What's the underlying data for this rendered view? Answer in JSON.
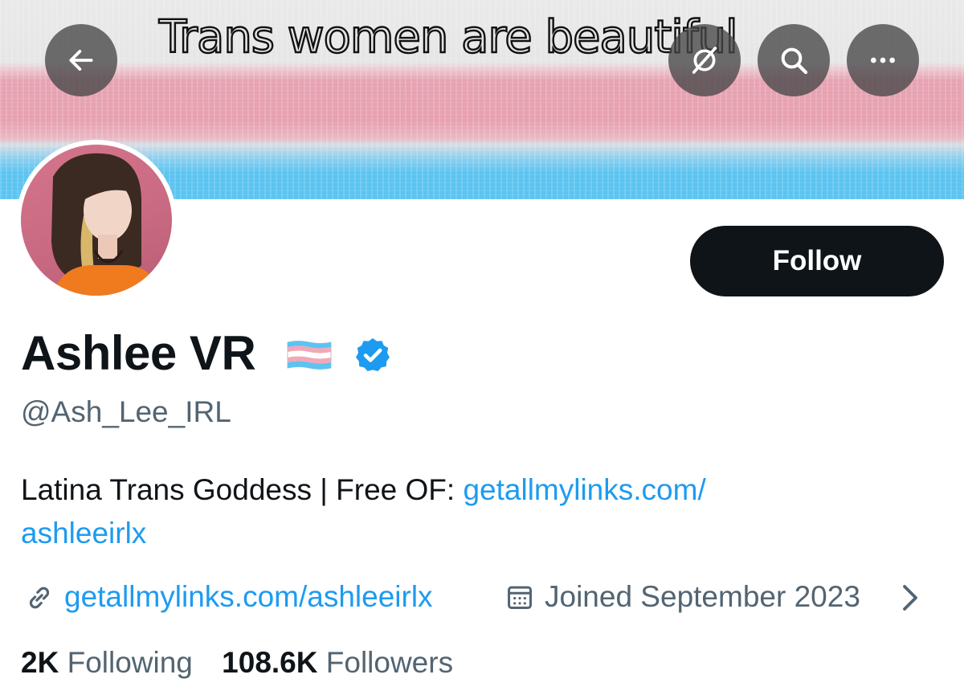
{
  "banner": {
    "text": "Trans women are beautiful",
    "colors": {
      "gray": "#e6e6e7",
      "pink": "#e8a0b0",
      "blue": "#5bc4f1"
    }
  },
  "header_buttons": [
    {
      "name": "back-button",
      "icon": "arrow-left-icon"
    },
    {
      "name": "grok-button",
      "icon": "grok-icon"
    },
    {
      "name": "search-button",
      "icon": "search-icon"
    },
    {
      "name": "more-button",
      "icon": "more-horizontal-icon"
    }
  ],
  "profile": {
    "display_name": "Ashlee VR",
    "flag_icon": "transgender-flag-icon",
    "verified_icon": "verified-badge-icon",
    "handle": "@Ash_Lee_IRL",
    "bio_text": "Latina Trans Goddess | Free OF: ",
    "bio_link_line1": "getallmylinks.com/",
    "bio_link_line2": "ashleeirlx",
    "website": "getallmylinks.com/ashleeirlx",
    "joined": "Joined September 2023"
  },
  "follow_button": {
    "label": "Follow"
  },
  "stats": {
    "following_count": "2K",
    "following_label": "Following",
    "followers_count": "108.6K",
    "followers_label": "Followers"
  },
  "colors": {
    "accent_link": "#1d9bf0",
    "verified": "#1d9bf0",
    "text_primary": "#0f1419",
    "text_secondary": "#536471",
    "follow_bg": "#0f1419"
  }
}
